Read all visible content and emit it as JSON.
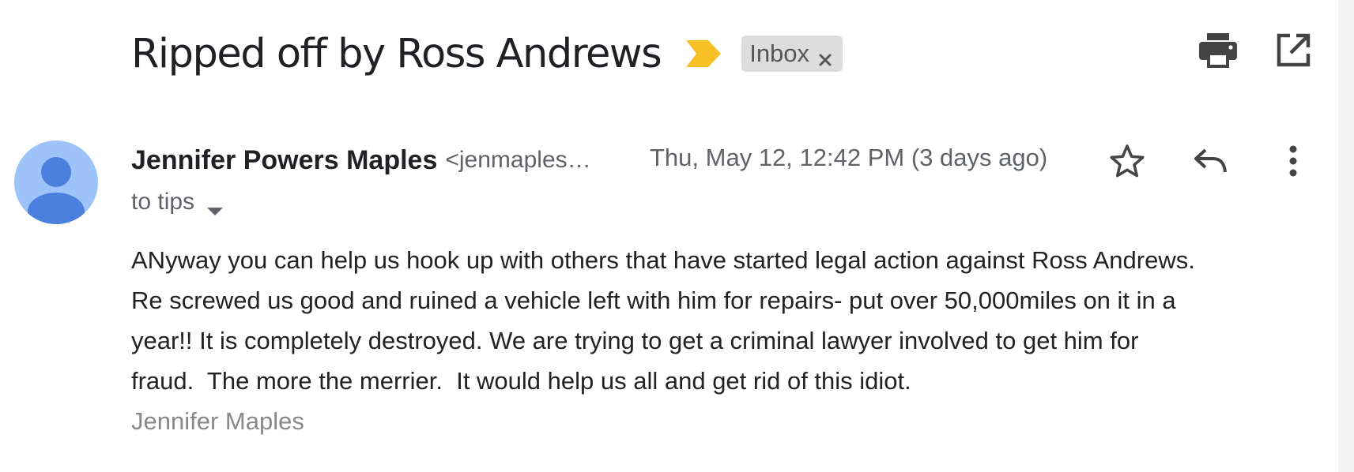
{
  "thread": {
    "subject": "Ripped off by Ross Andrews",
    "label": "Inbox",
    "importance_icon": "importance-marker-icon",
    "importance_color": "#f6c026",
    "toolbar": {
      "print_icon": "print-icon",
      "popout_icon": "open-in-new-window-icon"
    }
  },
  "message": {
    "sender_name": "Jennifer Powers Maples",
    "sender_email": "<jenmaples…",
    "date": "Thu, May 12, 12:42 PM (3 days ago)",
    "recipient": "to tips",
    "avatar_color": "#9ec2fa",
    "avatar_figure_color": "#4a7fde",
    "actions": {
      "star_icon": "star-icon",
      "reply_icon": "reply-icon",
      "more_icon": "more-options-icon"
    },
    "body_lines": [
      "ANyway you can help us hook up with others that have started legal action against Ross Andrews.",
      "Re screwed us good and ruined a vehicle left with him for repairs- put over 50,000miles on it in a",
      "year!! It is completely destroyed. We are trying to get a criminal lawyer involved to get him for",
      "fraud.  The more the merrier.  It would help us all and get rid of this idiot."
    ],
    "signature": "Jennifer Maples"
  }
}
